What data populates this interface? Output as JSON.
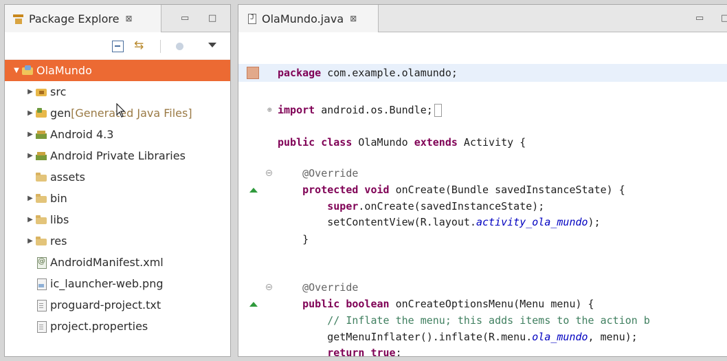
{
  "package_explorer": {
    "tab_title": "Package Explore",
    "close_glyph": "⊠",
    "minimize_glyph": "▭",
    "maximize_glyph": "□",
    "items": [
      {
        "label": "OlaMundo",
        "suffix": "",
        "twisty": "▼",
        "icon": "project-icon",
        "depth": 0,
        "selected": true
      },
      {
        "label": "src",
        "suffix": "",
        "twisty": "▶",
        "icon": "source-folder-icon",
        "depth": 1,
        "selected": false
      },
      {
        "label": "gen",
        "suffix": " [Generated Java Files]",
        "twisty": "▶",
        "icon": "generated-folder-icon",
        "depth": 1,
        "selected": false
      },
      {
        "label": "Android 4.3",
        "suffix": "",
        "twisty": "▶",
        "icon": "library-icon",
        "depth": 1,
        "selected": false
      },
      {
        "label": "Android Private Libraries",
        "suffix": "",
        "twisty": "▶",
        "icon": "library-icon",
        "depth": 1,
        "selected": false
      },
      {
        "label": "assets",
        "suffix": "",
        "twisty": "",
        "icon": "folder-icon",
        "depth": 1,
        "selected": false
      },
      {
        "label": "bin",
        "suffix": "",
        "twisty": "▶",
        "icon": "folder-icon",
        "depth": 1,
        "selected": false
      },
      {
        "label": "libs",
        "suffix": "",
        "twisty": "▶",
        "icon": "folder-icon",
        "depth": 1,
        "selected": false
      },
      {
        "label": "res",
        "suffix": "",
        "twisty": "▶",
        "icon": "folder-icon",
        "depth": 1,
        "selected": false
      },
      {
        "label": "AndroidManifest.xml",
        "suffix": "",
        "twisty": "",
        "icon": "xml-file-icon",
        "depth": 1,
        "selected": false
      },
      {
        "label": "ic_launcher-web.png",
        "suffix": "",
        "twisty": "",
        "icon": "image-file-icon",
        "depth": 1,
        "selected": false
      },
      {
        "label": "proguard-project.txt",
        "suffix": "",
        "twisty": "",
        "icon": "text-file-icon",
        "depth": 1,
        "selected": false
      },
      {
        "label": "project.properties",
        "suffix": "",
        "twisty": "",
        "icon": "text-file-icon",
        "depth": 1,
        "selected": false
      }
    ]
  },
  "editor": {
    "tab_title": "OlaMundo.java",
    "close_glyph": "⊠",
    "minimize_glyph": "▭",
    "maximize_glyph": "□",
    "lines": [
      [
        {
          "t": "package",
          "c": "kw"
        },
        {
          "t": " com.example.olamundo;",
          "c": ""
        }
      ],
      [
        {
          "t": "import",
          "c": "kw"
        },
        {
          "t": " android.os.Bundle;",
          "c": ""
        }
      ],
      [
        {
          "t": "public class",
          "c": "kw"
        },
        {
          "t": " OlaMundo ",
          "c": ""
        },
        {
          "t": "extends",
          "c": "kw"
        },
        {
          "t": " Activity {",
          "c": ""
        }
      ],
      [
        {
          "t": "    @Override",
          "c": "an"
        }
      ],
      [
        {
          "t": "    ",
          "c": ""
        },
        {
          "t": "protected void",
          "c": "kw"
        },
        {
          "t": " onCreate(Bundle savedInstanceState) {",
          "c": ""
        }
      ],
      [
        {
          "t": "        ",
          "c": ""
        },
        {
          "t": "super",
          "c": "kw"
        },
        {
          "t": ".onCreate(savedInstanceState);",
          "c": ""
        }
      ],
      [
        {
          "t": "        setContentView(R.layout.",
          "c": ""
        },
        {
          "t": "activity_ola_mundo",
          "c": "it"
        },
        {
          "t": ");",
          "c": ""
        }
      ],
      [
        {
          "t": "    }",
          "c": ""
        }
      ],
      [
        {
          "t": "    @Override",
          "c": "an"
        }
      ],
      [
        {
          "t": "    ",
          "c": ""
        },
        {
          "t": "public boolean",
          "c": "kw"
        },
        {
          "t": " onCreateOptionsMenu(Menu menu) {",
          "c": ""
        }
      ],
      [
        {
          "t": "        // Inflate the menu; this adds items to the action b",
          "c": "cm"
        }
      ],
      [
        {
          "t": "        getMenuInflater().inflate(R.menu.",
          "c": ""
        },
        {
          "t": "ola_mundo",
          "c": "it"
        },
        {
          "t": ", menu);",
          "c": ""
        }
      ],
      [
        {
          "t": "        ",
          "c": ""
        },
        {
          "t": "return true",
          "c": "kw"
        },
        {
          "t": ";",
          "c": ""
        }
      ],
      [
        {
          "t": "    }",
          "c": ""
        }
      ]
    ]
  },
  "colors": {
    "selection": "#ec6a33",
    "keyword": "#7f0055",
    "annotation": "#646464",
    "comment": "#3f7f5f",
    "field": "#0000c0",
    "current_line": "#e8f0fb"
  }
}
